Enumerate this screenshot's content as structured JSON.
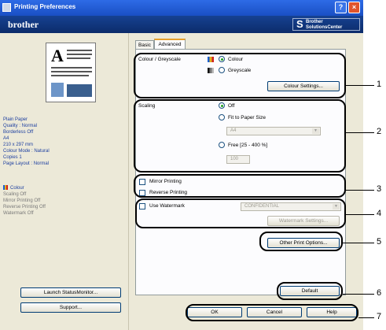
{
  "window": {
    "title": "Printing Preferences",
    "help": "?",
    "close": "×"
  },
  "banner": {
    "logo": "brother",
    "solutions_line1": "Brother",
    "solutions_line2": "SolutionsCenter"
  },
  "preview_glyph": "A",
  "summary": [
    "Plain Paper",
    "Quality : Normal",
    "Borderless Off",
    "A4",
    "210 x 297 mm",
    "Colour Mode : Natural",
    "Copies 1",
    "Page Layout : Normal"
  ],
  "summary2": {
    "colour": "Colour",
    "lines": [
      "Scaling Off",
      "Mirror Printing Off",
      "Reverse Printing Off",
      "Watermark Off"
    ]
  },
  "left_buttons": {
    "launch": "Launch StatusMonitor...",
    "support": "Support..."
  },
  "tabs": [
    "Basic",
    "Advanced"
  ],
  "colour_section": {
    "label": "Colour / Greyscale",
    "colour": "Colour",
    "greyscale": "Greyscale",
    "settings_btn": "Colour Settings..."
  },
  "scaling_section": {
    "label": "Scaling",
    "off": "Off",
    "fit": "Fit to Paper Size",
    "paper": "A4",
    "free": "Free [25 - 400 %]",
    "percent": "100"
  },
  "mirror": "Mirror Printing",
  "reverse": "Reverse Printing",
  "watermark": {
    "label": "Use Watermark",
    "value": "CONFIDENTIAL",
    "settings_btn": "Watermark Settings..."
  },
  "other_btn": "Other Print Options...",
  "default_btn": "Default",
  "bottom": {
    "ok": "OK",
    "cancel": "Cancel",
    "help": "Help"
  },
  "callouts": [
    "1",
    "2",
    "3",
    "4",
    "5",
    "6",
    "7"
  ]
}
